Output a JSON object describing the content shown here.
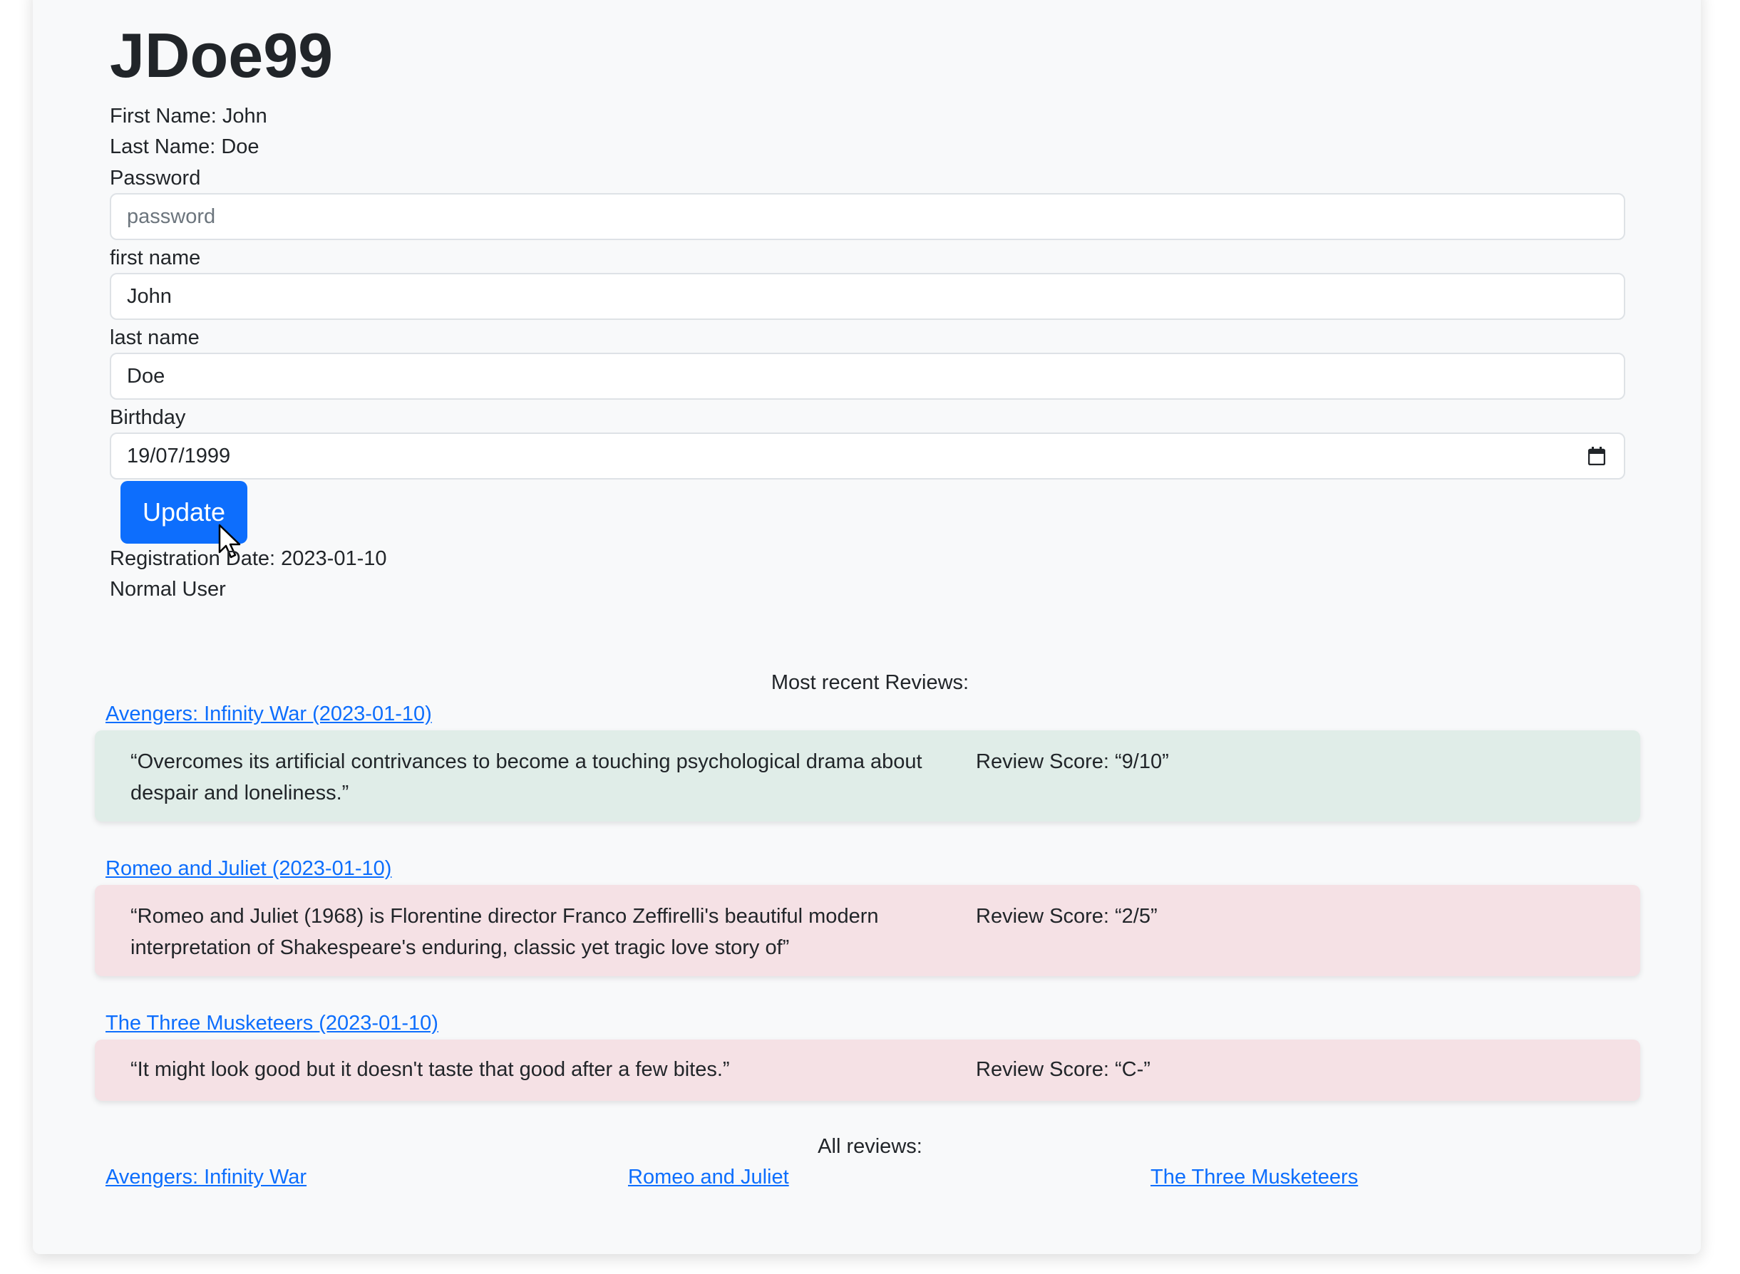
{
  "profile": {
    "username": "JDoe99",
    "first_name_line": "First Name: John",
    "last_name_line": "Last Name: Doe",
    "registration_date_line": "Registration Date: 2023-01-10",
    "user_type": "Normal User"
  },
  "form": {
    "password_label": "Password",
    "password_placeholder": "password",
    "password_value": "",
    "first_name_label": "first name",
    "first_name_value": "John",
    "last_name_label": "last name",
    "last_name_value": "Doe",
    "birthday_label": "Birthday",
    "birthday_value": "19/07/1999",
    "update_label": "Update"
  },
  "recent_reviews": {
    "heading": "Most recent Reviews:",
    "items": [
      {
        "title": "Avengers: Infinity War (2023-01-10)",
        "quote": "“Overcomes its artificial contrivances to become a touching psychological drama about despair and loneliness.”",
        "score": "Review Score: “9/10”",
        "color": "#e0ede8"
      },
      {
        "title": "Romeo and Juliet (2023-01-10)",
        "quote": "“Romeo and Juliet (1968) is Florentine director Franco Zeffirelli's beautiful modern interpretation of Shakespeare's enduring, classic yet tragic love story of”",
        "score": "Review Score: “2/5”",
        "color": "#f5e1e5"
      },
      {
        "title": "The Three Musketeers (2023-01-10)",
        "quote": "“It might look good but it doesn't taste that good after a few bites.”",
        "score": "Review Score: “C-”",
        "color": "#f5e1e5"
      }
    ]
  },
  "all_reviews": {
    "heading": "All reviews:",
    "links": [
      "Avengers: Infinity War",
      "Romeo and Juliet",
      "The Three Musketeers"
    ]
  },
  "icons": {
    "calendar": "calendar-icon",
    "cursor": "mouse-pointer-icon"
  },
  "colors": {
    "primary": "#0d6efd",
    "good_review": "#e0ede8",
    "bad_review": "#f5e1e5"
  }
}
